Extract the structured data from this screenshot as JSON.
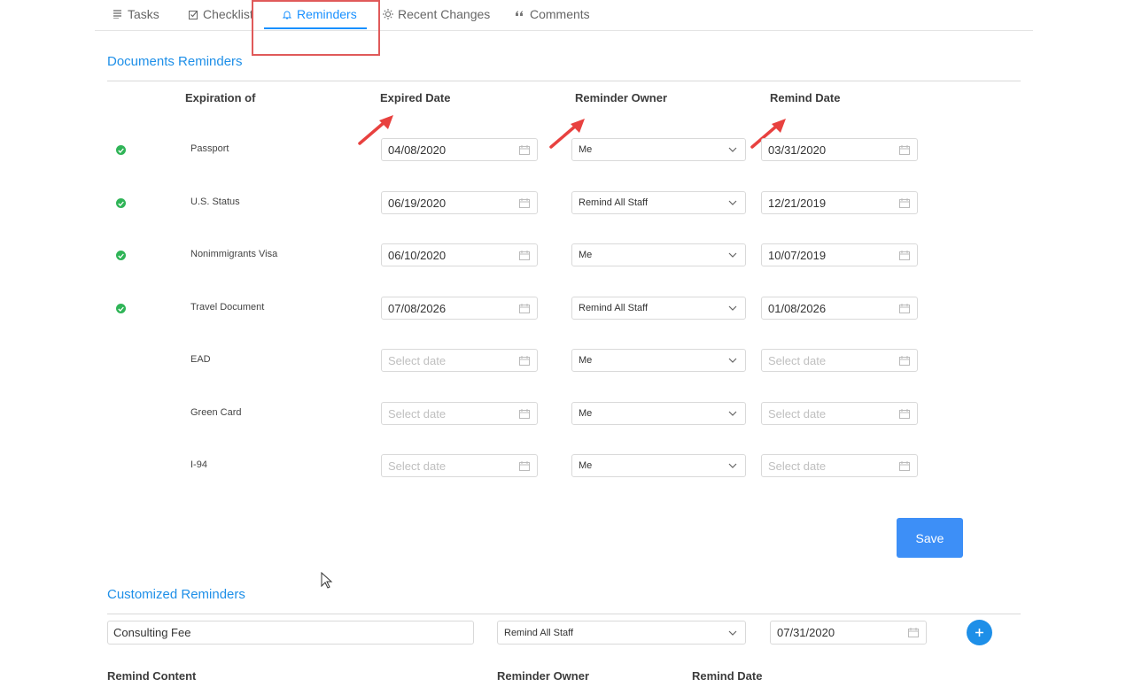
{
  "tabs": [
    {
      "label": "Tasks",
      "icon": "list-icon"
    },
    {
      "label": "Checklist",
      "icon": "checklist-icon"
    },
    {
      "label": "Reminders",
      "icon": "bell-icon",
      "active": true
    },
    {
      "label": "Recent Changes",
      "icon": "sun-icon"
    },
    {
      "label": "Comments",
      "icon": "quote-icon"
    }
  ],
  "documents": {
    "title": "Documents Reminders",
    "headers": {
      "expiration_of": "Expiration of",
      "expired_date": "Expired Date",
      "reminder_owner": "Reminder Owner",
      "remind_date": "Remind Date"
    },
    "rows": [
      {
        "label": "Passport",
        "checked": true,
        "expired": "04/08/2020",
        "owner": "Me",
        "remind": "03/31/2020"
      },
      {
        "label": "U.S. Status",
        "checked": true,
        "expired": "06/19/2020",
        "owner": "Remind All Staff",
        "remind": "12/21/2019"
      },
      {
        "label": "Nonimmigrants Visa",
        "checked": true,
        "expired": "06/10/2020",
        "owner": "Me",
        "remind": "10/07/2019"
      },
      {
        "label": "Travel Document",
        "checked": true,
        "expired": "07/08/2026",
        "owner": "Remind All Staff",
        "remind": "01/08/2026"
      },
      {
        "label": "EAD",
        "checked": false,
        "expired": "",
        "owner": "Me",
        "remind": ""
      },
      {
        "label": "Green Card",
        "checked": false,
        "expired": "",
        "owner": "Me",
        "remind": ""
      },
      {
        "label": "I-94",
        "checked": false,
        "expired": "",
        "owner": "Me",
        "remind": ""
      }
    ],
    "date_placeholder": "Select date",
    "save_label": "Save"
  },
  "customized": {
    "title": "Customized Reminders",
    "content_value": "Consulting Fee",
    "owner_value": "Remind All Staff",
    "date_value": "07/31/2020",
    "headers": {
      "remind_content": "Remind Content",
      "reminder_owner": "Reminder Owner",
      "remind_date": "Remind Date"
    }
  },
  "colors": {
    "accent": "#1890ff",
    "success": "#2fb457",
    "annotation": "#e05a5a",
    "primary_button": "#3d8ff7"
  }
}
